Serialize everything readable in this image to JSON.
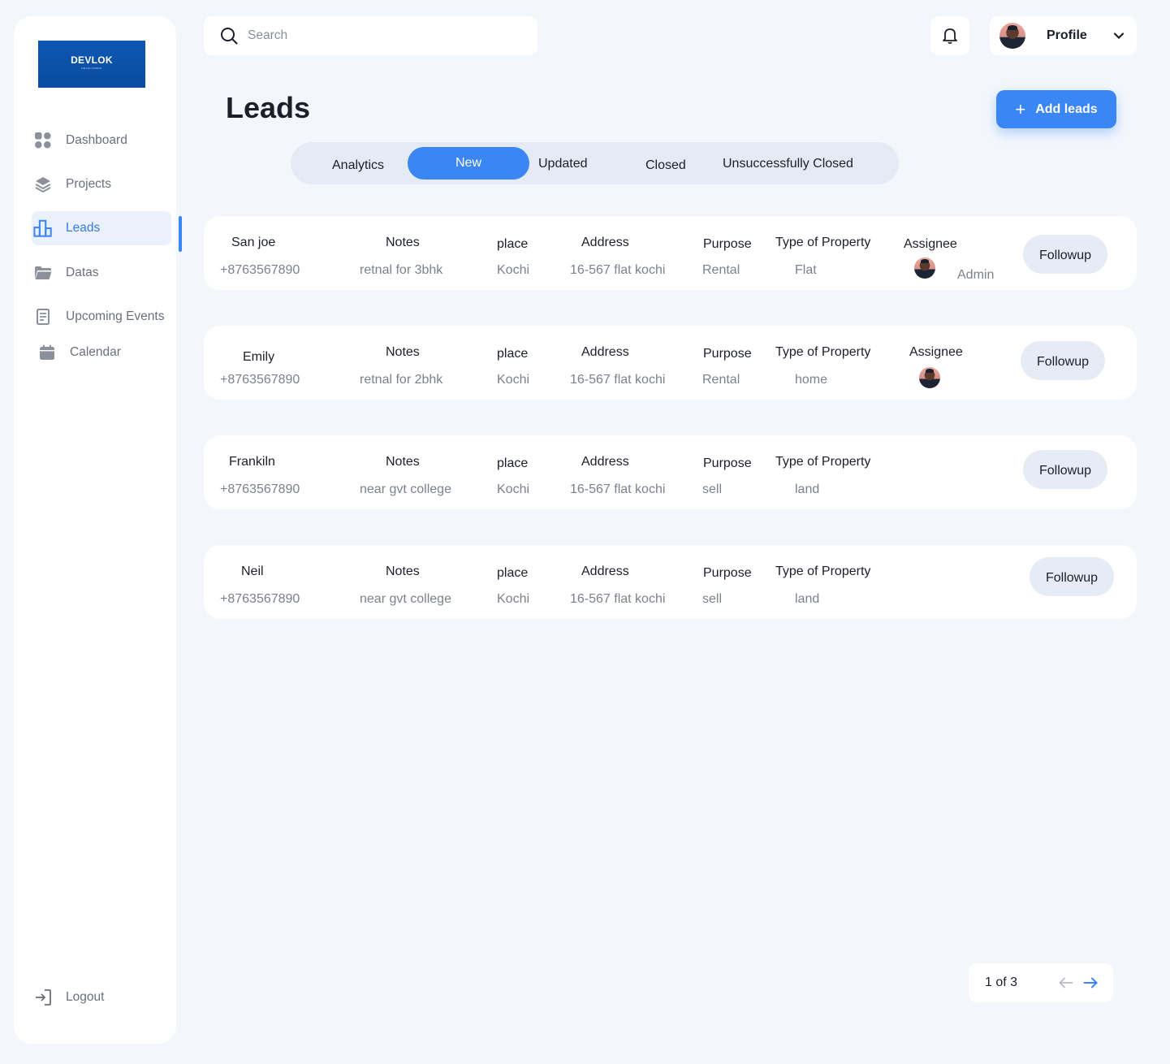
{
  "brand": {
    "name": "DEVLOK",
    "tagline": "DEVELOPERS"
  },
  "sidebar": {
    "items": [
      {
        "label": "Dashboard",
        "icon": "grid-icon"
      },
      {
        "label": "Projects",
        "icon": "layers-icon"
      },
      {
        "label": "Leads",
        "icon": "bar-chart-icon",
        "active": true
      },
      {
        "label": "Datas",
        "icon": "folder-icon"
      },
      {
        "label": "Upcoming Events",
        "icon": "document-icon"
      },
      {
        "label": "Calendar",
        "icon": "calendar-icon"
      }
    ],
    "logout_label": "Logout"
  },
  "search": {
    "placeholder": "Search",
    "value": ""
  },
  "profile": {
    "name": "Profile"
  },
  "page": {
    "title": "Leads",
    "add_button_label": "Add leads"
  },
  "tabs": [
    {
      "label": "Analytics"
    },
    {
      "label": "New",
      "active": true
    },
    {
      "label": "Updated"
    },
    {
      "label": "Closed"
    },
    {
      "label": "Unsuccessfully Closed"
    }
  ],
  "columns": {
    "notes": "Notes",
    "place": "place",
    "address": "Address",
    "purpose": "Purpose",
    "type": "Type of Property",
    "assignee": "Assignee"
  },
  "leads": [
    {
      "name": "San joe",
      "phone": "+8763567890",
      "notes": "retnal for 3bhk",
      "place": "Kochi",
      "address": "16-567 flat kochi",
      "purpose": "Rental",
      "type": "Flat",
      "assignee_name": "Admin",
      "followup": "Followup"
    },
    {
      "name": "Emily",
      "phone": "+8763567890",
      "notes": "retnal for 2bhk",
      "place": "Kochi",
      "address": "16-567 flat kochi",
      "purpose": "Rental",
      "type": "home",
      "followup": "Followup"
    },
    {
      "name": "Frankiln",
      "phone": "+8763567890",
      "notes": "near gvt college",
      "place": "Kochi",
      "address": "16-567 flat kochi",
      "purpose": "sell",
      "type": "land",
      "followup": "Followup"
    },
    {
      "name": "Neil",
      "phone": "+8763567890",
      "notes": "near gvt college",
      "place": "Kochi",
      "address": "16-567 flat kochi",
      "purpose": "sell",
      "type": "land",
      "followup": "Followup"
    }
  ],
  "pagination": {
    "text": "1 of 3"
  },
  "colors": {
    "accent": "#3a86f4",
    "background": "#f3f7fc",
    "brand": "#0c57b3"
  }
}
